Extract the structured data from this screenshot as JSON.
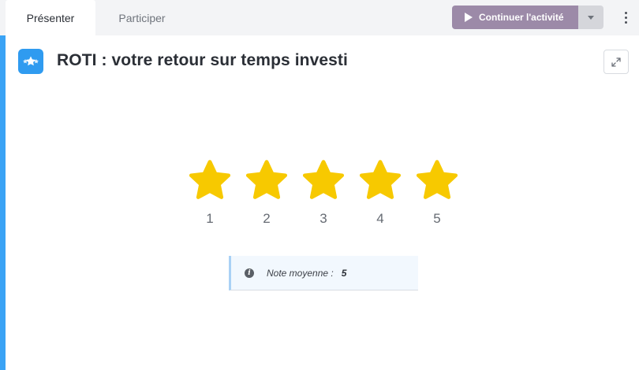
{
  "tabs": [
    {
      "label": "Présenter",
      "active": true
    },
    {
      "label": "Participer",
      "active": false
    }
  ],
  "toolbar": {
    "continue_label": "Continuer l'activité",
    "continue_icon": "play-icon",
    "dropdown_icon": "caret-down-icon",
    "more_icon": "kebab-icon"
  },
  "activity": {
    "title": "ROTI : votre retour sur temps investi",
    "icon": "stars-icon",
    "expand_icon": "expand-icon"
  },
  "rating": {
    "stars": [
      {
        "label": "1",
        "filled": true
      },
      {
        "label": "2",
        "filled": true
      },
      {
        "label": "3",
        "filled": true
      },
      {
        "label": "4",
        "filled": true
      },
      {
        "label": "5",
        "filled": true
      }
    ]
  },
  "summary": {
    "label": "Note moyenne :",
    "value": "5",
    "icon": "info-icon"
  },
  "colors": {
    "accent": "#3aa3f5",
    "star": "#f7c900",
    "continue_button": "#9c8aa8"
  }
}
